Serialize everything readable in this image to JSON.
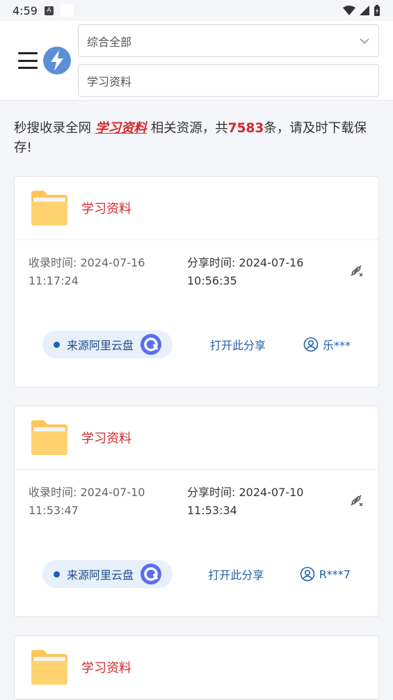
{
  "status": {
    "time": "4:59",
    "a_icon": "A"
  },
  "header": {
    "category": "综合全部",
    "search_value": "学习资料"
  },
  "summary": {
    "prefix": "秒搜收录全网 ",
    "keyword": "学习资料",
    "middle": " 相关资源，共",
    "count": "7583",
    "suffix": "条，请及时下载保存!"
  },
  "labels": {
    "collect": "收录时间: ",
    "share": "分享时间: ",
    "source": "来源阿里云盘",
    "open": "打开此分享"
  },
  "cards": [
    {
      "title": "学习资料",
      "collect_date": "2024-07-16",
      "collect_time": "11:17:24",
      "share_date": "2024-07-16",
      "share_time": "10:56:35",
      "user": "乐***"
    },
    {
      "title": "学习资料",
      "collect_date": "2024-07-10",
      "collect_time": "11:53:47",
      "share_date": "2024-07-10",
      "share_time": "11:53:34",
      "user": "R***7"
    },
    {
      "title": "学习资料"
    }
  ],
  "colors": {
    "accent_red": "#d6262a",
    "link_blue": "#1f5fa8",
    "pill_bg": "#e8f0fb"
  }
}
